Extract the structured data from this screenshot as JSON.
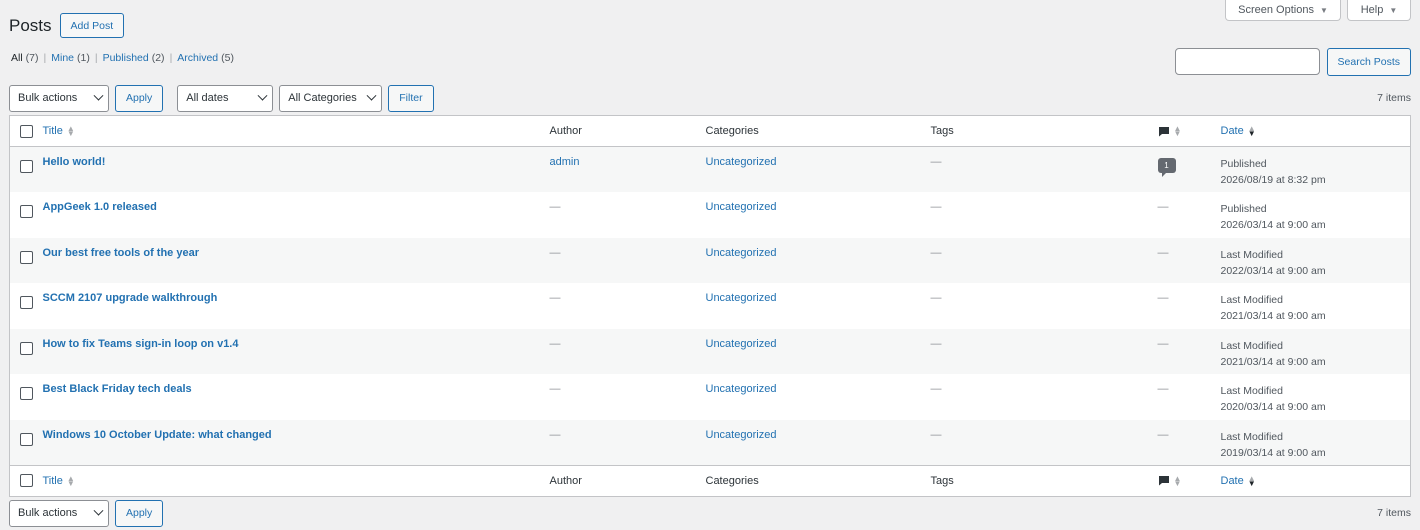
{
  "screen_meta": {
    "screen_options": "Screen Options",
    "help": "Help",
    "caret": "▼"
  },
  "page": {
    "title": "Posts",
    "add_new": "Add Post"
  },
  "views": [
    {
      "label": "All",
      "count": "(7)"
    },
    {
      "label": "Mine",
      "count": "(1)"
    },
    {
      "label": "Published",
      "count": "(2)"
    },
    {
      "label": "Archived",
      "count": "(5)"
    }
  ],
  "search": {
    "placeholder": "",
    "button": "Search Posts"
  },
  "tablenav": {
    "bulk_actions": "Bulk actions",
    "apply": "Apply",
    "all_dates": "All dates",
    "all_categories": "All Categories",
    "filter": "Filter",
    "items_count": "7 items"
  },
  "columns": {
    "title": "Title",
    "author": "Author",
    "categories": "Categories",
    "tags": "Tags",
    "date": "Date"
  },
  "rows": [
    {
      "title": "Hello world!",
      "author": "admin",
      "category": "Uncategorized",
      "tags": "—",
      "comments": "1",
      "status": "Published",
      "date": "2026/08/19 at 8:32 pm"
    },
    {
      "title": "AppGeek 1.0 released",
      "author": "—",
      "category": "Uncategorized",
      "tags": "—",
      "comments": "—",
      "status": "Published",
      "date": "2026/03/14 at 9:00 am"
    },
    {
      "title": "Our best free tools of the year",
      "author": "—",
      "category": "Uncategorized",
      "tags": "—",
      "comments": "—",
      "status": "Last Modified",
      "date": "2022/03/14 at 9:00 am"
    },
    {
      "title": "SCCM 2107 upgrade walkthrough",
      "author": "—",
      "category": "Uncategorized",
      "tags": "—",
      "comments": "—",
      "status": "Last Modified",
      "date": "2021/03/14 at 9:00 am"
    },
    {
      "title": "How to fix Teams sign-in loop on v1.4",
      "author": "—",
      "category": "Uncategorized",
      "tags": "—",
      "comments": "—",
      "status": "Last Modified",
      "date": "2021/03/14 at 9:00 am"
    },
    {
      "title": "Best Black Friday tech deals",
      "author": "—",
      "category": "Uncategorized",
      "tags": "—",
      "comments": "—",
      "status": "Last Modified",
      "date": "2020/03/14 at 9:00 am"
    },
    {
      "title": "Windows 10 October Update: what changed",
      "author": "—",
      "category": "Uncategorized",
      "tags": "—",
      "comments": "—",
      "status": "Last Modified",
      "date": "2019/03/14 at 9:00 am"
    }
  ],
  "colors": {
    "link": "#2271b1",
    "background": "#f0f0f1",
    "border": "#c3c4c7"
  }
}
